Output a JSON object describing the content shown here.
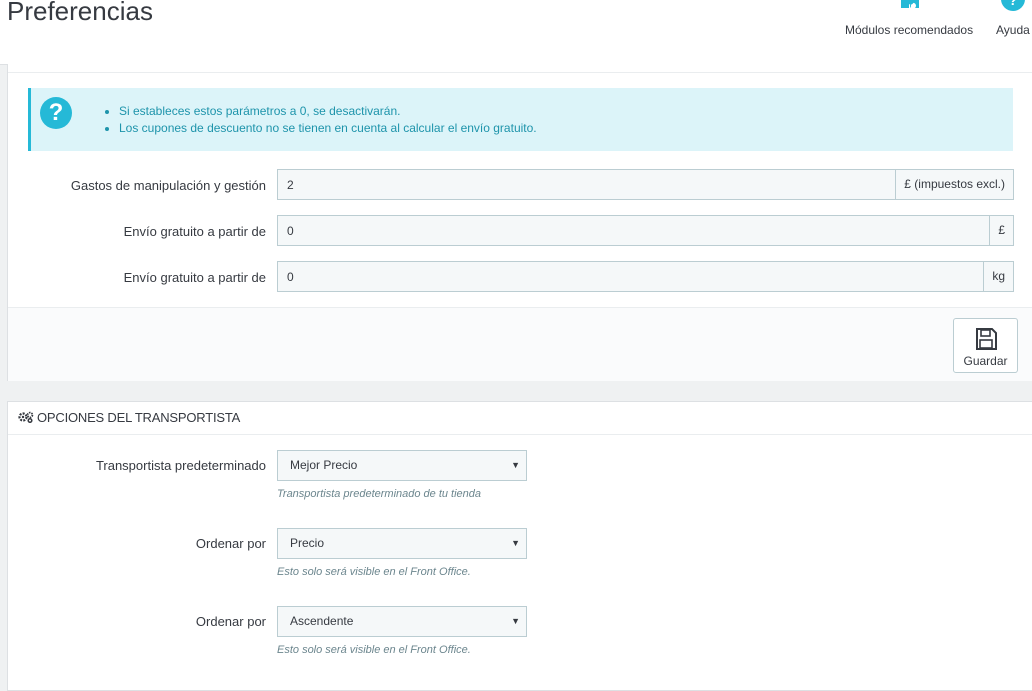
{
  "header": {
    "title": "Preferencias",
    "toolbar": [
      {
        "label": "Módulos recomendados",
        "icon": "puzzle-icon"
      },
      {
        "label": "Ayuda",
        "icon": "help-icon"
      }
    ]
  },
  "handling": {
    "alert": [
      "Si estableces estos parámetros a 0, se desactivarán.",
      "Los cupones de descuento no se tienen en cuenta al calcular el envío gratuito."
    ],
    "fields": [
      {
        "label": "Gastos de manipulación y gestión",
        "value": "2",
        "addon": "£ (impuestos excl.)"
      },
      {
        "label": "Envío gratuito a partir de",
        "value": "0",
        "addon": "£"
      },
      {
        "label": "Envío gratuito a partir de",
        "value": "0",
        "addon": "kg"
      }
    ],
    "save_label": "Guardar"
  },
  "carrier_options": {
    "title": "OPCIONES DEL TRANSPORTISTA",
    "fields": [
      {
        "label": "Transportista predeterminado",
        "value": "Mejor Precio",
        "help": "Transportista predeterminado de tu tienda"
      },
      {
        "label": "Ordenar por",
        "value": "Precio",
        "help": "Esto solo será visible en el Front Office."
      },
      {
        "label": "Ordenar por",
        "value": "Ascendente",
        "help": "Esto solo será visible en el Front Office."
      }
    ]
  },
  "colors": {
    "accent": "#25b9d7",
    "alert_bg": "#dcf4f9",
    "alert_text": "#1e94ab"
  }
}
